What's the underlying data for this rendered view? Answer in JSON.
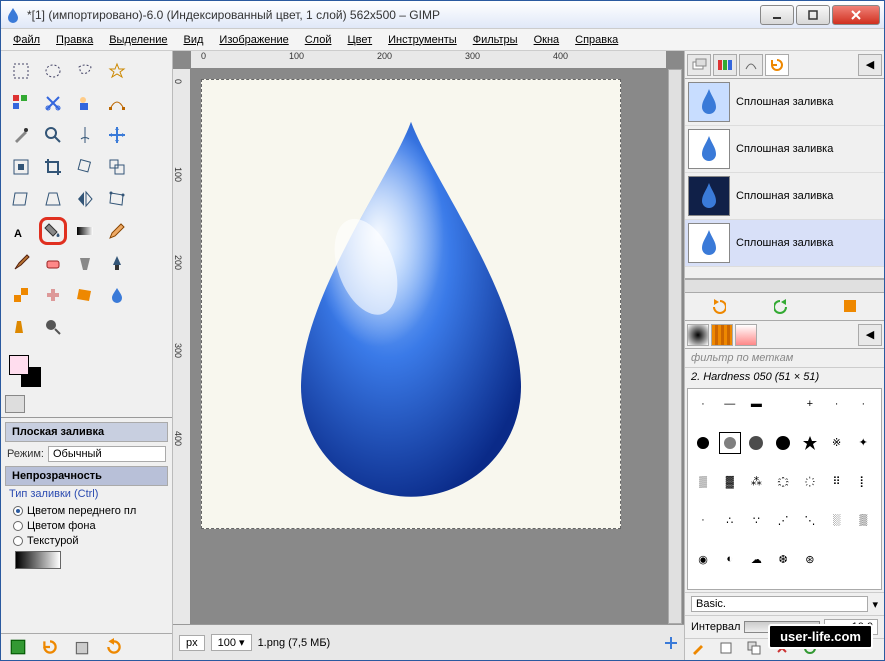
{
  "title": "*[1] (импортировано)-6.0 (Индексированный цвет, 1 слой) 562x500 – GIMP",
  "menu": [
    "Файл",
    "Правка",
    "Выделение",
    "Вид",
    "Изображение",
    "Слой",
    "Цвет",
    "Инструменты",
    "Фильтры",
    "Окна",
    "Справка"
  ],
  "ruler_h": [
    "0",
    "100",
    "200",
    "300",
    "400"
  ],
  "ruler_v": [
    "0",
    "100",
    "200",
    "300",
    "400"
  ],
  "status": {
    "unit": "px",
    "zoom": "100",
    "file": "1.png (7,5 МБ)"
  },
  "tool_options": {
    "title": "Плоская заливка",
    "mode_label": "Режим:",
    "mode_value": "Обычный",
    "opacity_label": "Непрозрачность",
    "fill_type_label": "Тип заливки (Ctrl)",
    "fill_fg": "Цветом переднего пл",
    "fill_bg": "Цветом фона",
    "fill_tex": "Текстурой"
  },
  "undo": {
    "items": [
      {
        "label": "Сплошная заливка",
        "bg": "#c8ddff"
      },
      {
        "label": "Сплошная заливка",
        "bg": "#ffffff"
      },
      {
        "label": "Сплошная заливка",
        "bg": "#102048"
      },
      {
        "label": "Сплошная заливка",
        "bg": "#ffffff"
      }
    ]
  },
  "brush": {
    "filter_placeholder": "фильтр по меткам",
    "selected_name": "2. Hardness 050 (51 × 51)",
    "preset_label": "Basic.",
    "interval_label": "Интервал",
    "interval_value": "10,0"
  },
  "watermark": "user-life.com"
}
